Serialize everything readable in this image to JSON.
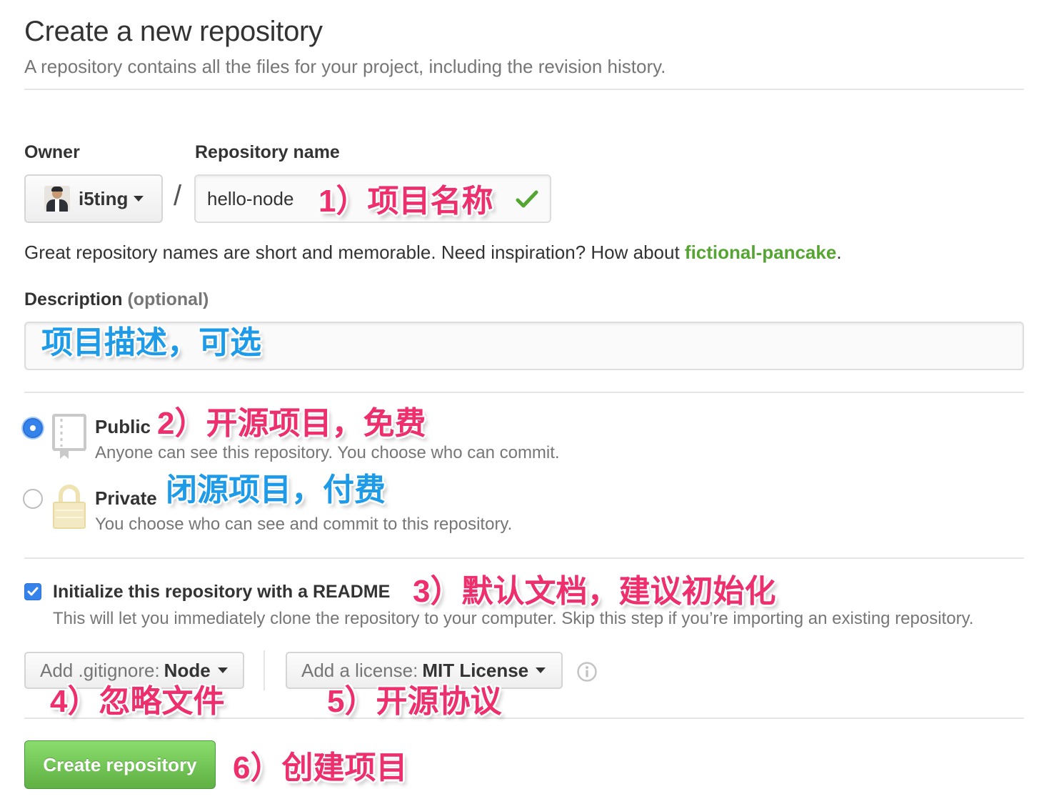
{
  "header": {
    "title": "Create a new repository",
    "subtitle": "A repository contains all the files for your project, including the revision history."
  },
  "owner": {
    "label": "Owner",
    "name": "i5ting"
  },
  "repo_name": {
    "label": "Repository name",
    "separator": "/",
    "value": "hello-node"
  },
  "hint": {
    "text": "Great repository names are short and memorable. Need inspiration? How about ",
    "suggestion": "fictional-pancake",
    "end": "."
  },
  "description": {
    "label": "Description",
    "optional": "(optional)",
    "value": ""
  },
  "visibility": {
    "public": {
      "title": "Public",
      "desc": "Anyone can see this repository. You choose who can commit.",
      "selected": true
    },
    "private": {
      "title": "Private",
      "desc": "You choose who can see and commit to this repository.",
      "selected": false
    }
  },
  "readme": {
    "label": "Initialize this repository with a README",
    "desc": "This will let you immediately clone the repository to your computer. Skip this step if you’re importing an existing repository.",
    "checked": true
  },
  "gitignore": {
    "prefix": "Add .gitignore:",
    "value": "Node"
  },
  "license": {
    "prefix": "Add a license:",
    "value": "MIT License"
  },
  "create_button": "Create repository",
  "annotations": {
    "a1": "1）项目名称",
    "a_desc": "项目描述，可选",
    "a2": "2）开源项目，免费",
    "a_private": "闭源项目，付费",
    "a3": "3）默认文档，建议初始化",
    "a4": "4）忽略文件",
    "a5": "5）开源协议",
    "a6": "6）创建项目"
  },
  "colors": {
    "accent_blue": "#3583ea",
    "create_green": "#60b044",
    "suggestion_green": "#55a532",
    "note_pink": "#ee2f6d",
    "note_blue": "#1e9be8"
  }
}
